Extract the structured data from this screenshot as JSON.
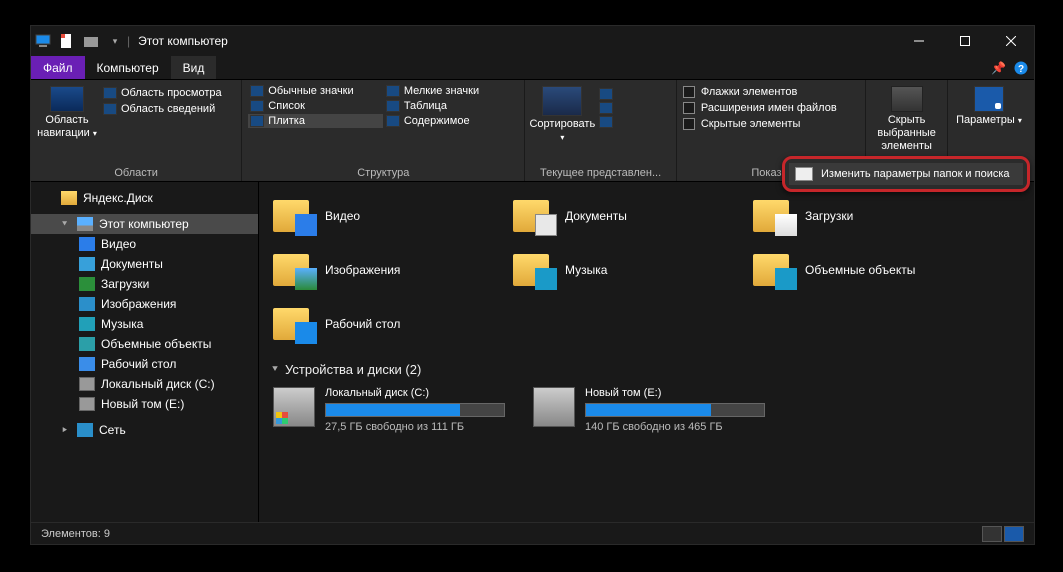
{
  "title": "Этот компьютер",
  "tabs": {
    "file": "Файл",
    "computer": "Компьютер",
    "view": "Вид"
  },
  "ribbon": {
    "panes": {
      "nav": "Область навигации",
      "preview": "Область просмотра",
      "details": "Область сведений",
      "group": "Области"
    },
    "layout": {
      "items": [
        "Обычные значки",
        "Мелкие значки",
        "Список",
        "Таблица",
        "Плитка",
        "Содержимое"
      ],
      "group": "Структура"
    },
    "sort": {
      "btn": "Сортировать",
      "group": "Текущее представлен..."
    },
    "show": {
      "chk1": "Флажки элементов",
      "chk2": "Расширения имен файлов",
      "chk3": "Скрытые элементы",
      "hide": "Скрыть выбранные элементы",
      "group": "Показ..."
    },
    "options": {
      "label": "Параметры",
      "dd": "Изменить параметры папок и поиска"
    }
  },
  "sidebar": {
    "yandex": "Яндекс.Диск",
    "thispc": "Этот компьютер",
    "items": [
      "Видео",
      "Документы",
      "Загрузки",
      "Изображения",
      "Музыка",
      "Объемные объекты",
      "Рабочий стол",
      "Локальный диск (C:)",
      "Новый том (E:)"
    ],
    "network": "Сеть"
  },
  "content": {
    "folders": [
      {
        "name": "Видео",
        "ov": "ov-vid"
      },
      {
        "name": "Документы",
        "ov": "ov-doc"
      },
      {
        "name": "Загрузки",
        "ov": "ov-dl"
      },
      {
        "name": "Изображения",
        "ov": "ov-img"
      },
      {
        "name": "Музыка",
        "ov": "ov-mus"
      },
      {
        "name": "Объемные объекты",
        "ov": "ov-3d"
      },
      {
        "name": "Рабочий стол",
        "ov": "ov-desk"
      }
    ],
    "section": "Устройства и диски (2)",
    "disks": [
      {
        "name": "Локальный диск (C:)",
        "free": "27,5 ГБ свободно из 111 ГБ",
        "fill": 75,
        "win": true
      },
      {
        "name": "Новый том (E:)",
        "free": "140 ГБ свободно из 465 ГБ",
        "fill": 70,
        "win": false
      }
    ]
  },
  "status": {
    "count": "Элементов: 9"
  }
}
